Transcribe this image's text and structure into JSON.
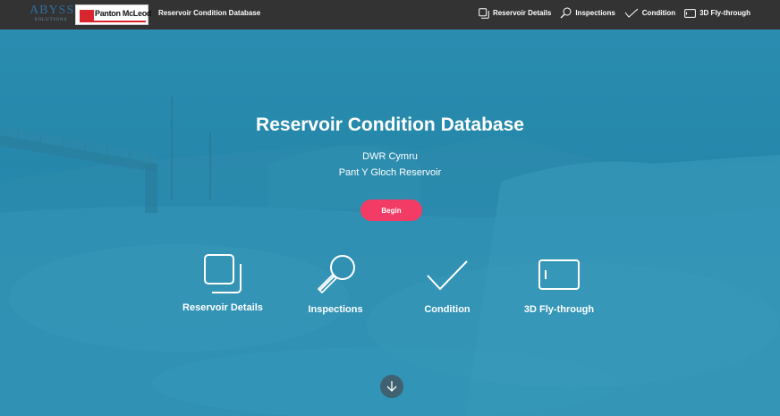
{
  "header": {
    "logo_abyss_text": "ABYSS",
    "logo_abyss_tagline": "SOLUTIONS",
    "logo_panton_text": "Panton McLeod",
    "title": "Reservoir Condition Database",
    "nav": [
      {
        "label": "Reservoir Details",
        "icon": "squares-icon"
      },
      {
        "label": "Inspections",
        "icon": "magnifier-icon"
      },
      {
        "label": "Condition",
        "icon": "checkmark-icon"
      },
      {
        "label": "3D Fly-through",
        "icon": "tablet-icon"
      }
    ]
  },
  "hero": {
    "title": "Reservoir Condition Database",
    "subtitle_line1": "DWR Cymru",
    "subtitle_line2": "Pant Y Gloch Reservoir",
    "begin_label": "Begin",
    "features": [
      {
        "label": "Reservoir Details",
        "icon": "squares-icon"
      },
      {
        "label": "Inspections",
        "icon": "magnifier-icon"
      },
      {
        "label": "Condition",
        "icon": "checkmark-icon"
      },
      {
        "label": "3D Fly-through",
        "icon": "tablet-icon"
      }
    ],
    "scroll_icon": "arrow-down-icon"
  },
  "colors": {
    "topbar": "#333333",
    "hero_tint": "#2588ab",
    "accent": "#f23c66"
  }
}
